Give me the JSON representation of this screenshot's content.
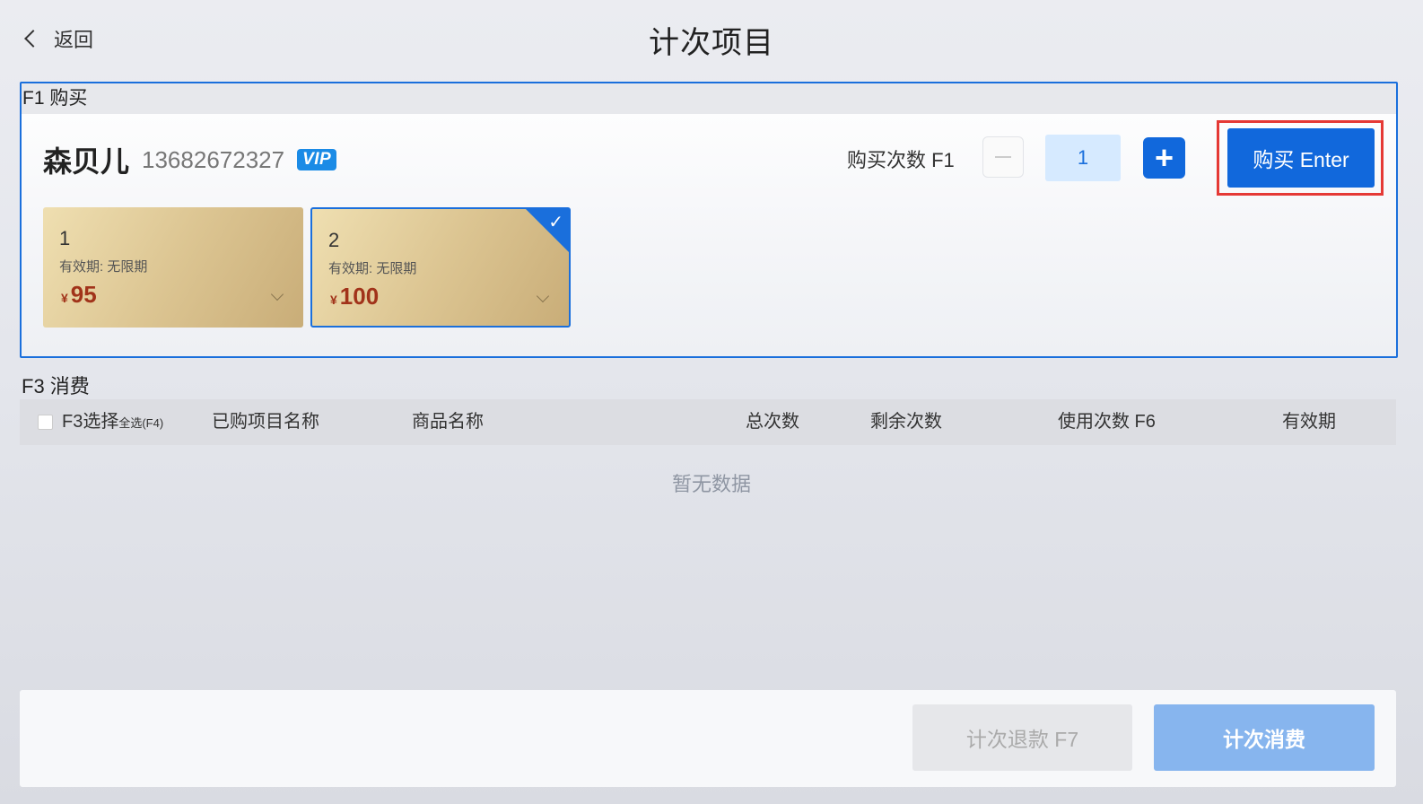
{
  "header": {
    "back_label": "返回",
    "title": "计次项目"
  },
  "purchase": {
    "section_label": "F1 购买",
    "member": {
      "name": "森贝儿",
      "phone": "13682672327",
      "badge": "VIP"
    },
    "quantity_label": "购买次数 F1",
    "quantity_value": "1",
    "plus_symbol": "+",
    "buy_button": "购买 Enter",
    "cards": [
      {
        "number": "1",
        "validity": "有效期: 无限期",
        "currency": "¥",
        "price": "95",
        "selected": false
      },
      {
        "number": "2",
        "validity": "有效期: 无限期",
        "currency": "¥",
        "price": "100",
        "selected": true
      }
    ],
    "check_symbol": "✓"
  },
  "consume": {
    "section_label": "F3 消费",
    "columns": {
      "select": "F3选择",
      "select_all": "全选(F4)",
      "purchased_name": "已购项目名称",
      "product_name": "商品名称",
      "total": "总次数",
      "remaining": "剩余次数",
      "use_count": "使用次数 F6",
      "validity": "有效期"
    },
    "empty_text": "暂无数据"
  },
  "footer": {
    "refund_button": "计次退款 F7",
    "consume_button": "计次消费"
  },
  "colors": {
    "primary": "#1168dc",
    "highlight_border": "#e53935",
    "price": "#a1331a",
    "consume_disabled": "#87b5ee"
  }
}
